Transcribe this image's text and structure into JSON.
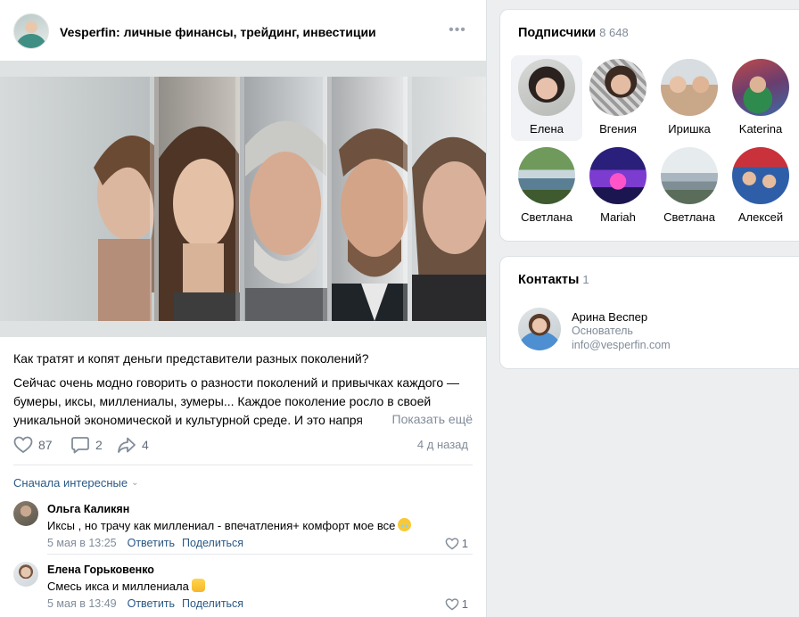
{
  "post": {
    "group_name": "Vesperfin: личные финансы, трейдинг, инвестиции",
    "more_icon": "more-horizontal-icon",
    "question": "Как тратят и копят деньги представители разных поколений?",
    "body": "Сейчас очень модно говорить о разности поколений и привычках каждого — бумеры, иксы, миллениалы, зумеры... Каждое поколение росло в своей уникальной экономической и культурной среде. И это напря",
    "show_more": "Показать ещё",
    "likes": "87",
    "comments": "2",
    "shares": "4",
    "date": "4 д назад",
    "icons": {
      "like": "heart-icon",
      "comment": "comment-icon",
      "share": "share-icon"
    }
  },
  "comments_sort": "Сначала интересные",
  "comments": [
    {
      "name": "Ольга Каликян",
      "text": "Иксы , но трачу как миллениал - впечатления+ комфорт мое все",
      "emoji": "laughing-emoji",
      "date": "5 мая в 13:25",
      "reply": "Ответить",
      "share": "Поделиться",
      "likes": "1"
    },
    {
      "name": "Елена Горьковенко",
      "text": "Смесь икса и миллениала",
      "emoji": "raised-hands-emoji",
      "date": "5 мая в 13:49",
      "reply": "Ответить",
      "share": "Поделиться",
      "likes": "1"
    }
  ],
  "subscribers": {
    "title": "Подписчики",
    "count": "8 648",
    "people": [
      {
        "name": "Елена"
      },
      {
        "name": "Вгения"
      },
      {
        "name": "Иришка"
      },
      {
        "name": "Katerina"
      },
      {
        "name": "Светлана"
      },
      {
        "name": "Mariah"
      },
      {
        "name": "Светлана"
      },
      {
        "name": "Алексей"
      }
    ]
  },
  "contacts": {
    "title": "Контакты",
    "count": "1",
    "person": {
      "name": "Арина Веспер",
      "role": "Основатель",
      "email": "info@vesperfin.com"
    }
  },
  "colors": {
    "link": "#2a5885",
    "secondary": "#818c99",
    "background": "#edeef0"
  }
}
